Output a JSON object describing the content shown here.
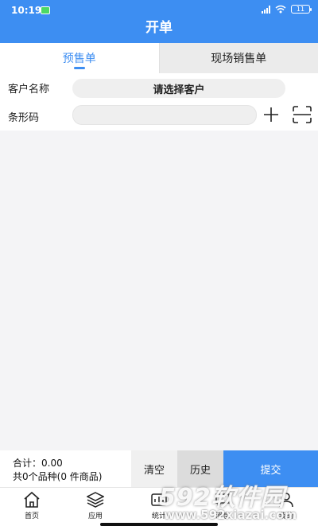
{
  "status_bar": {
    "time": "10:19",
    "battery": "11"
  },
  "header": {
    "title": "开单"
  },
  "tabs": [
    {
      "label": "预售单",
      "active": true
    },
    {
      "label": "现场销售单",
      "active": false
    }
  ],
  "form": {
    "customer": {
      "label": "客户名称",
      "value": "请选择客户"
    },
    "barcode": {
      "label": "条形码",
      "value": ""
    }
  },
  "footer": {
    "total_label": "合计：",
    "total_value": "0.00",
    "count_text": "共0个品种(0 件商品)",
    "clear_label": "清空",
    "history_label": "历史",
    "submit_label": "提交"
  },
  "nav": [
    {
      "label": "首页",
      "icon": "home-icon"
    },
    {
      "label": "应用",
      "icon": "layers-icon"
    },
    {
      "label": "统计",
      "icon": "stats-icon"
    },
    {
      "label": "消息",
      "icon": "message-icon"
    },
    {
      "label": "我的",
      "icon": "user-icon"
    }
  ],
  "watermark": {
    "brand": "592软件园",
    "url": "www.592xiazai.com"
  },
  "colors": {
    "accent": "#3d8ef2",
    "background": "#f4f4f6"
  }
}
